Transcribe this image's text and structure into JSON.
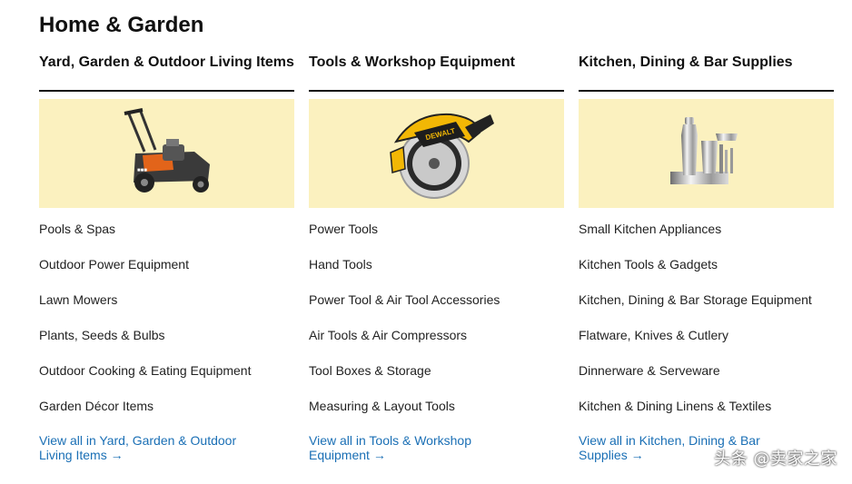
{
  "page": {
    "title": "Home & Garden"
  },
  "columns": [
    {
      "heading": "Yard, Garden & Outdoor Living Items",
      "image": "lawn-mower",
      "links": [
        "Pools & Spas",
        "Outdoor Power Equipment",
        "Lawn Mowers",
        "Plants, Seeds & Bulbs",
        "Outdoor Cooking & Eating Equipment",
        "Garden Décor Items"
      ],
      "view_all": "View all in Yard, Garden & Outdoor Living Items →"
    },
    {
      "heading": "Tools & Workshop Equipment",
      "image": "circular-saw",
      "links": [
        "Power Tools",
        "Hand Tools",
        "Power Tool & Air Tool Accessories",
        "Air Tools & Air Compressors",
        "Tool Boxes & Storage",
        "Measuring & Layout Tools"
      ],
      "view_all": "View all in Tools & Workshop Equipment →"
    },
    {
      "heading": "Kitchen, Dining & Bar Supplies",
      "image": "cocktail-shaker-set",
      "links": [
        "Small Kitchen Appliances",
        "Kitchen Tools & Gadgets",
        "Kitchen, Dining & Bar Storage Equipment",
        "Flatware, Knives & Cutlery",
        "Dinnerware & Serveware",
        "Kitchen & Dining Linens & Textiles"
      ],
      "view_all": "View all in Kitchen, Dining & Bar Supplies →"
    }
  ],
  "saw_brand": "DEWALT",
  "watermark": "头条 @卖家之家",
  "colors": {
    "banner": "#fbf1bf",
    "link": "#1a6fb5",
    "heading_rule": "#111111"
  }
}
